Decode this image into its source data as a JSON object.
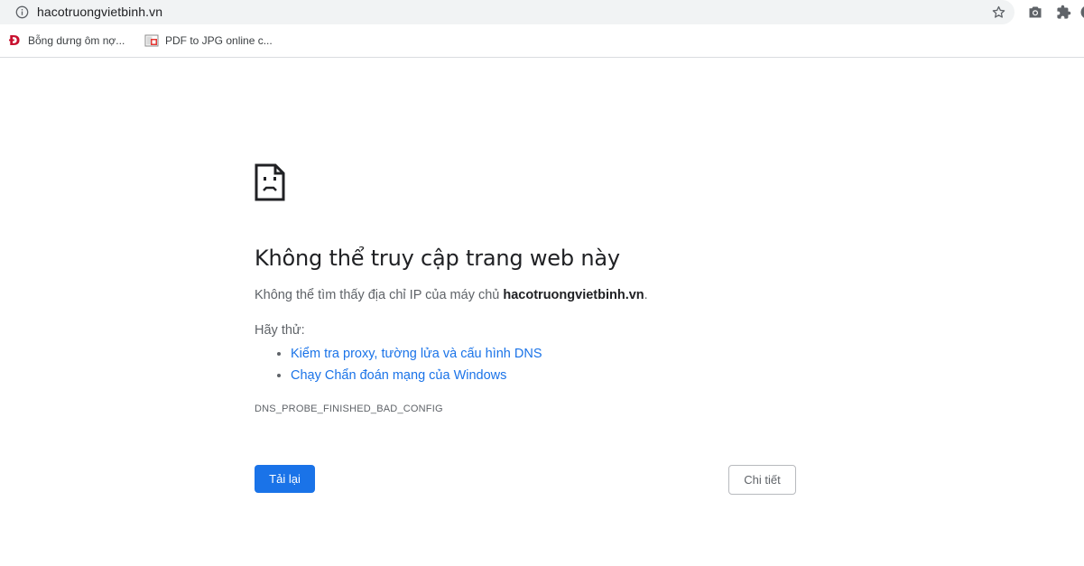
{
  "omnibox": {
    "url": "hacotruongvietbinh.vn",
    "info_icon": "info-icon",
    "star_icon": "star-icon"
  },
  "extensions": {
    "icons": [
      "camera-icon",
      "puzzle-icon"
    ]
  },
  "bookmarks": {
    "items": [
      {
        "label": "Bỗng dưng ôm nợ...",
        "favicon": "Đ",
        "favicon_color": "#c8102e"
      },
      {
        "label": "PDF to JPG online c...",
        "favicon": "pdf-to-jpg-icon"
      }
    ]
  },
  "error_page": {
    "icon": "sad-page-icon",
    "headline": "Không thể truy cập trang web này",
    "summary_prefix": "Không thể tìm thấy địa chỉ IP của máy chủ ",
    "summary_host": "hacotruongvietbinh.vn",
    "summary_suffix": ".",
    "try_label": "Hãy thử:",
    "suggestions": [
      "Kiểm tra proxy, tường lửa và cấu hình DNS",
      "Chạy Chẩn đoán mạng của Windows"
    ],
    "error_code": "DNS_PROBE_FINISHED_BAD_CONFIG",
    "reload_label": "Tải lại",
    "details_label": "Chi tiết"
  },
  "colors": {
    "primary_button": "#1a73e8",
    "link": "#1a73e8",
    "omnibox_bg": "#f1f3f4"
  }
}
